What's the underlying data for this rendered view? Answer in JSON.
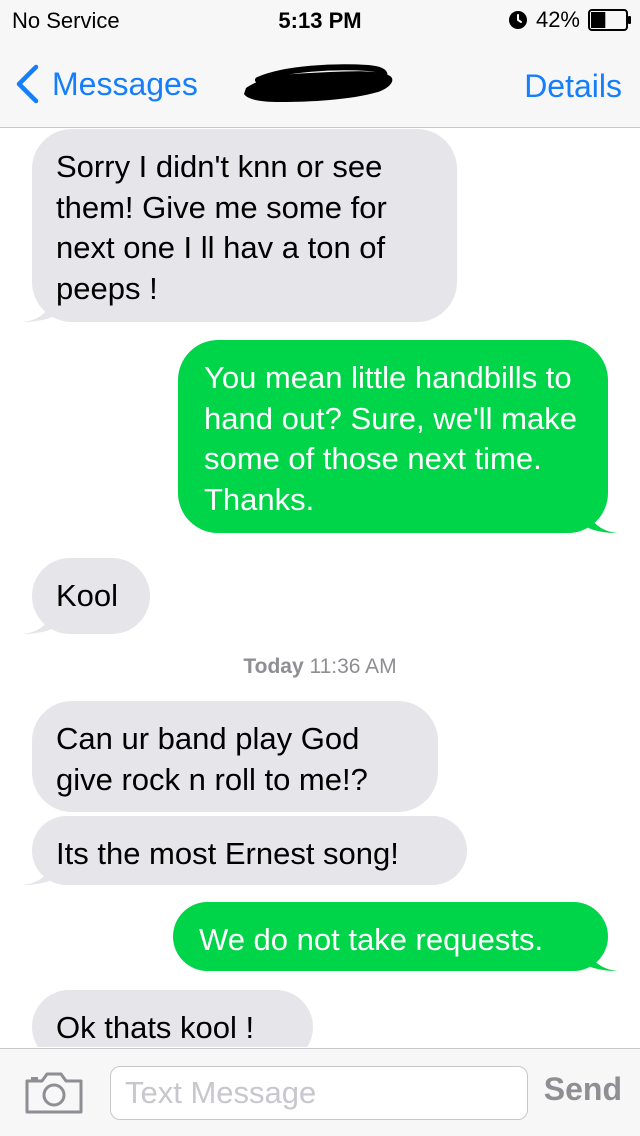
{
  "status_bar": {
    "carrier": "No Service",
    "time": "5:13 PM",
    "battery": "42%",
    "battery_level": 0.42,
    "icons": [
      "alarm-icon",
      "battery-icon"
    ]
  },
  "nav": {
    "back_label": "Messages",
    "details_label": "Details",
    "icons": [
      "chevron-left-icon"
    ]
  },
  "thread": {
    "messages": [
      {
        "direction": "incoming",
        "text": "Sorry I didn't knn or see them! Give me some for next one I ll hav a ton of peeps !"
      },
      {
        "direction": "outgoing",
        "text": "You mean little handbills to hand out? Sure, we'll make some of those next time. Thanks."
      },
      {
        "direction": "incoming",
        "text": "Kool"
      },
      {
        "direction": "incoming",
        "text": "Can ur band play God give rock n roll to me!?"
      },
      {
        "direction": "incoming",
        "text": "Its the most Ernest song!"
      },
      {
        "direction": "outgoing",
        "text": "We do not take requests."
      },
      {
        "direction": "incoming",
        "text": "Ok thats kool !"
      }
    ],
    "timestamp": {
      "day": "Today",
      "time": "11:36 AM"
    }
  },
  "input_bar": {
    "placeholder": "Text Message",
    "send_label": "Send",
    "icons": [
      "camera-icon"
    ]
  },
  "colors": {
    "incoming_bubble": "#e5e5ea",
    "outgoing_bubble": "#00d549",
    "ios_blue": "#157efb",
    "bar_background": "#f7f7f8"
  }
}
